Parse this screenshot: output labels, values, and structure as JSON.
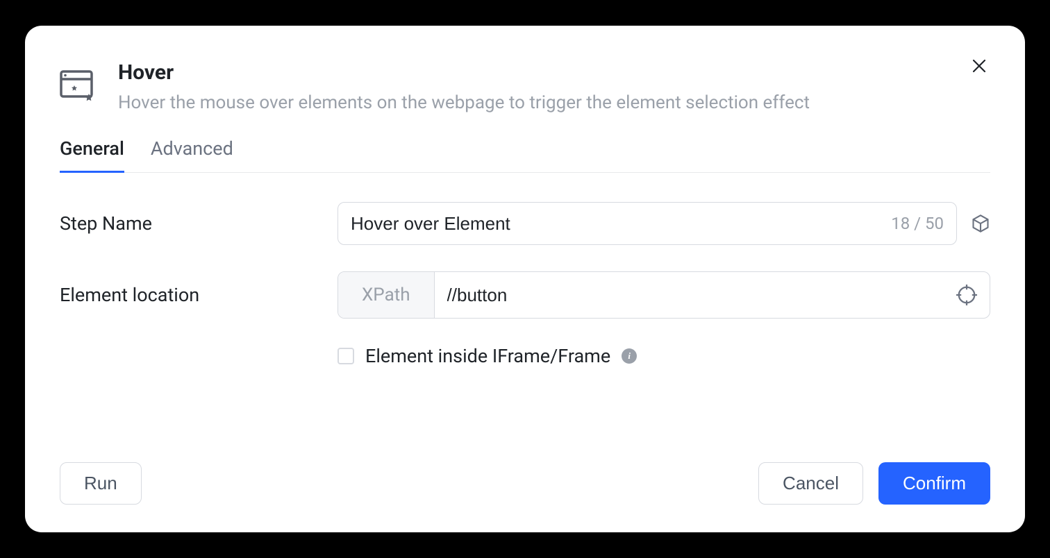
{
  "header": {
    "title": "Hover",
    "subtitle": "Hover the mouse over elements on the webpage to trigger the element selection effect"
  },
  "tabs": {
    "general": "General",
    "advanced": "Advanced"
  },
  "form": {
    "step_name": {
      "label": "Step Name",
      "value": "Hover over Element",
      "count": "18 / 50"
    },
    "element_location": {
      "label": "Element location",
      "prefix": "XPath",
      "value": "//button"
    },
    "iframe_checkbox": {
      "label": "Element inside IFrame/Frame"
    }
  },
  "footer": {
    "run": "Run",
    "cancel": "Cancel",
    "confirm": "Confirm"
  }
}
